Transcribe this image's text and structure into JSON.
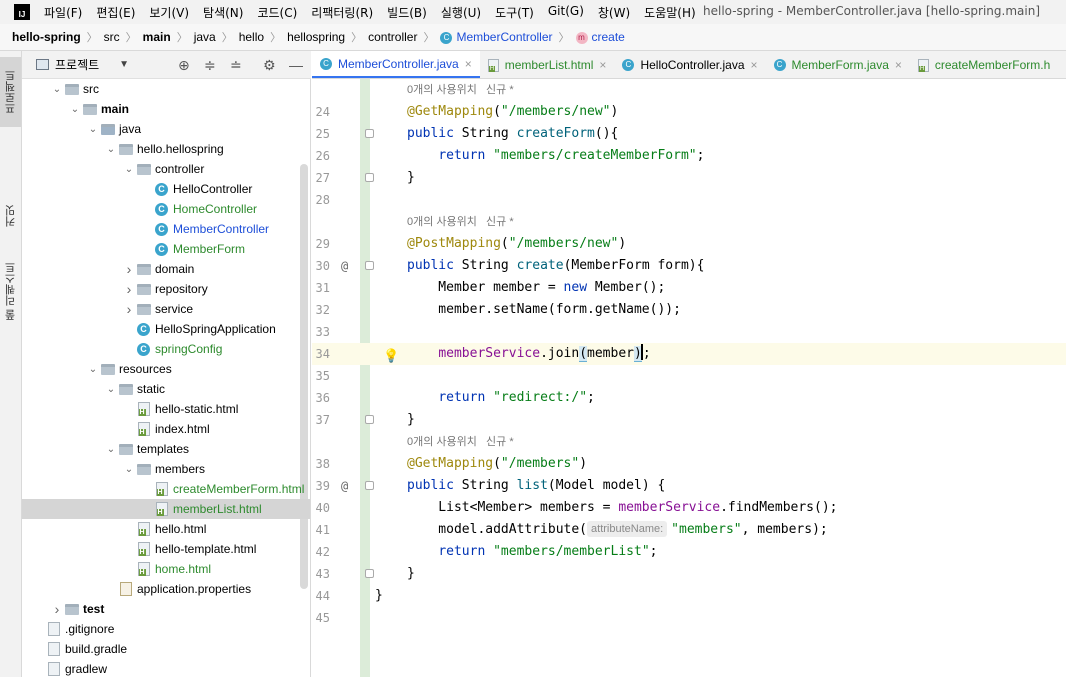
{
  "menubar": {
    "logo": "IJ",
    "items": [
      "파일(F)",
      "편집(E)",
      "보기(V)",
      "탐색(N)",
      "코드(C)",
      "리팩터링(R)",
      "빌드(B)",
      "실행(U)",
      "도구(T)",
      "Git(G)",
      "창(W)",
      "도움말(H)"
    ],
    "window_title": "hello-spring - MemberController.java [hello-spring.main]"
  },
  "breadcrumb": {
    "items": [
      "hello-spring",
      "src",
      "main",
      "java",
      "hello",
      "hellospring",
      "controller",
      "MemberController",
      "create"
    ]
  },
  "tool_strip": {
    "project": "프로젝트",
    "commit": "커밋",
    "pull_requests": "풀 리퀘스트"
  },
  "project_panel": {
    "title": "프로젝트",
    "tree": [
      {
        "label": "src",
        "indent": 2,
        "arrow": "open",
        "icon": "folder"
      },
      {
        "label": "main",
        "indent": 3,
        "arrow": "open",
        "icon": "folder",
        "bold": true
      },
      {
        "label": "java",
        "indent": 4,
        "arrow": "open",
        "icon": "folder-src"
      },
      {
        "label": "hello.hellospring",
        "indent": 5,
        "arrow": "open",
        "icon": "package"
      },
      {
        "label": "controller",
        "indent": 6,
        "arrow": "open",
        "icon": "package"
      },
      {
        "label": "HelloController",
        "indent": 7,
        "arrow": "none",
        "icon": "class"
      },
      {
        "label": "HomeController",
        "indent": 7,
        "arrow": "none",
        "icon": "class",
        "color": "green"
      },
      {
        "label": "MemberController",
        "indent": 7,
        "arrow": "none",
        "icon": "class",
        "color": "blue"
      },
      {
        "label": "MemberForm",
        "indent": 7,
        "arrow": "none",
        "icon": "class",
        "color": "green"
      },
      {
        "label": "domain",
        "indent": 6,
        "arrow": "closed",
        "icon": "package"
      },
      {
        "label": "repository",
        "indent": 6,
        "arrow": "closed",
        "icon": "package"
      },
      {
        "label": "service",
        "indent": 6,
        "arrow": "closed",
        "icon": "package"
      },
      {
        "label": "HelloSpringApplication",
        "indent": 6,
        "arrow": "none",
        "icon": "class"
      },
      {
        "label": "springConfig",
        "indent": 6,
        "arrow": "none",
        "icon": "class",
        "color": "green"
      },
      {
        "label": "resources",
        "indent": 4,
        "arrow": "open",
        "icon": "folder"
      },
      {
        "label": "static",
        "indent": 5,
        "arrow": "open",
        "icon": "folder"
      },
      {
        "label": "hello-static.html",
        "indent": 6,
        "arrow": "none",
        "icon": "html"
      },
      {
        "label": "index.html",
        "indent": 6,
        "arrow": "none",
        "icon": "html"
      },
      {
        "label": "templates",
        "indent": 5,
        "arrow": "open",
        "icon": "folder"
      },
      {
        "label": "members",
        "indent": 6,
        "arrow": "open",
        "icon": "folder"
      },
      {
        "label": "createMemberForm.html",
        "indent": 7,
        "arrow": "none",
        "icon": "html",
        "color": "green"
      },
      {
        "label": "memberList.html",
        "indent": 7,
        "arrow": "none",
        "icon": "html",
        "color": "green",
        "selected": true
      },
      {
        "label": "hello.html",
        "indent": 6,
        "arrow": "none",
        "icon": "html"
      },
      {
        "label": "hello-template.html",
        "indent": 6,
        "arrow": "none",
        "icon": "html"
      },
      {
        "label": "home.html",
        "indent": 6,
        "arrow": "none",
        "icon": "html",
        "color": "green"
      },
      {
        "label": "application.properties",
        "indent": 5,
        "arrow": "none",
        "icon": "props"
      },
      {
        "label": "test",
        "indent": 2,
        "arrow": "closed",
        "icon": "folder",
        "bold": true
      },
      {
        "label": ".gitignore",
        "indent": 1,
        "arrow": "none",
        "icon": "file"
      },
      {
        "label": "build.gradle",
        "indent": 1,
        "arrow": "none",
        "icon": "file"
      },
      {
        "label": "gradlew",
        "indent": 1,
        "arrow": "none",
        "icon": "file"
      }
    ]
  },
  "tabs": [
    {
      "label": "MemberController.java",
      "icon": "class",
      "active": true
    },
    {
      "label": "memberList.html",
      "icon": "html",
      "color": "green"
    },
    {
      "label": "HelloController.java",
      "icon": "class"
    },
    {
      "label": "MemberForm.java",
      "icon": "class",
      "color": "green"
    },
    {
      "label": "createMemberForm.h",
      "icon": "html",
      "color": "green"
    }
  ],
  "editor": {
    "lines": [
      {
        "type": "hint",
        "text": "0개의 사용위치   신규 *"
      },
      {
        "num": "24",
        "tokens": [
          [
            "ann",
            "@GetMapping"
          ],
          [
            "fn",
            "("
          ],
          [
            "str",
            "\"/members/new\""
          ],
          [
            "fn",
            ")"
          ]
        ]
      },
      {
        "num": "25",
        "fold": true,
        "tokens": [
          [
            "kw",
            "public "
          ],
          [
            "fn",
            "String "
          ],
          [
            "mth",
            "createForm"
          ],
          [
            "fn",
            "(){"
          ]
        ]
      },
      {
        "num": "26",
        "tokens": [
          [
            "fn",
            "    "
          ],
          [
            "kw",
            "return "
          ],
          [
            "str",
            "\"members/createMemberForm\""
          ],
          [
            "fn",
            ";"
          ]
        ]
      },
      {
        "num": "27",
        "fold": true,
        "tokens": [
          [
            "fn",
            "}"
          ]
        ]
      },
      {
        "num": "28",
        "tokens": []
      },
      {
        "type": "hint",
        "text": "0개의 사용위치   신규 *"
      },
      {
        "num": "29",
        "tokens": [
          [
            "ann",
            "@PostMapping"
          ],
          [
            "fn",
            "("
          ],
          [
            "str",
            "\"/members/new\""
          ],
          [
            "fn",
            ")"
          ]
        ]
      },
      {
        "num": "30",
        "at": true,
        "fold": true,
        "tokens": [
          [
            "kw",
            "public "
          ],
          [
            "fn",
            "String "
          ],
          [
            "mth",
            "create"
          ],
          [
            "fn",
            "(MemberForm form){"
          ]
        ]
      },
      {
        "num": "31",
        "tokens": [
          [
            "fn",
            "    Member member = "
          ],
          [
            "kw",
            "new "
          ],
          [
            "fn",
            "Member();"
          ]
        ]
      },
      {
        "num": "32",
        "tokens": [
          [
            "fn",
            "    member.setName(form.getName());"
          ]
        ]
      },
      {
        "num": "33",
        "tokens": []
      },
      {
        "num": "34",
        "current": true,
        "bulb": true,
        "tokens": [
          [
            "fn",
            "    "
          ],
          [
            "fld",
            "memberService"
          ],
          [
            "fn",
            ".join"
          ],
          [
            "bracket",
            "("
          ],
          [
            "fn",
            "member"
          ],
          [
            "bracket",
            ")"
          ],
          [
            "caret",
            ""
          ],
          [
            "fn",
            ";"
          ]
        ]
      },
      {
        "num": "35",
        "tokens": []
      },
      {
        "num": "36",
        "tokens": [
          [
            "fn",
            "    "
          ],
          [
            "kw",
            "return "
          ],
          [
            "str",
            "\"redirect:/\""
          ],
          [
            "fn",
            ";"
          ]
        ]
      },
      {
        "num": "37",
        "fold": true,
        "tokens": [
          [
            "fn",
            "}"
          ]
        ]
      },
      {
        "type": "hint",
        "text": "0개의 사용위치   신규 *"
      },
      {
        "num": "38",
        "tokens": [
          [
            "ann",
            "@GetMapping"
          ],
          [
            "fn",
            "("
          ],
          [
            "str",
            "\"/members\""
          ],
          [
            "fn",
            ")"
          ]
        ]
      },
      {
        "num": "39",
        "at": true,
        "fold": true,
        "tokens": [
          [
            "kw",
            "public "
          ],
          [
            "fn",
            "String "
          ],
          [
            "mth",
            "list"
          ],
          [
            "fn",
            "(Model model) {"
          ]
        ]
      },
      {
        "num": "40",
        "tokens": [
          [
            "fn",
            "    List<Member> members = "
          ],
          [
            "fld",
            "memberService"
          ],
          [
            "fn",
            ".findMembers();"
          ]
        ]
      },
      {
        "num": "41",
        "tokens": [
          [
            "fn",
            "    model.addAttribute("
          ],
          [
            "inlay",
            "attributeName:"
          ],
          [
            "str",
            "\"members\""
          ],
          [
            "fn",
            ", members);"
          ]
        ]
      },
      {
        "num": "42",
        "tokens": [
          [
            "fn",
            "    "
          ],
          [
            "kw",
            "return "
          ],
          [
            "str",
            "\"members/memberList\""
          ],
          [
            "fn",
            ";"
          ]
        ]
      },
      {
        "num": "43",
        "fold": true,
        "tokens": [
          [
            "fn",
            "}"
          ]
        ]
      },
      {
        "num": "44",
        "outdent": true,
        "tokens": [
          [
            "fn",
            "}"
          ]
        ]
      },
      {
        "num": "45",
        "tokens": []
      }
    ]
  }
}
